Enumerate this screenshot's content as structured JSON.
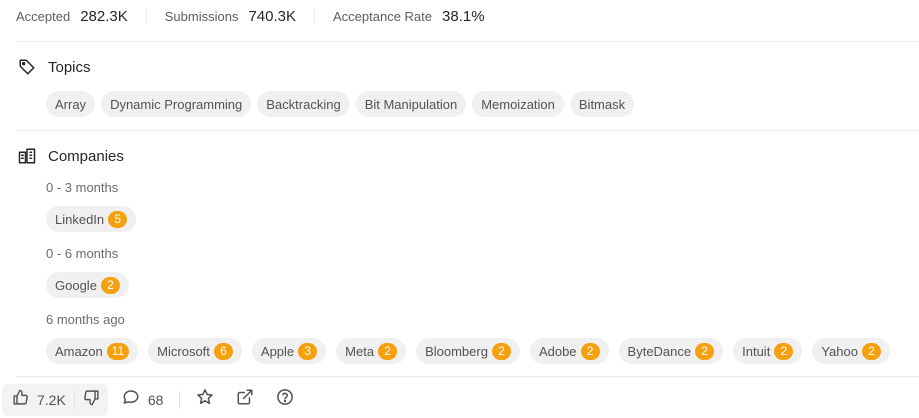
{
  "stats": {
    "accepted_label": "Accepted",
    "accepted_value": "282.3K",
    "submissions_label": "Submissions",
    "submissions_value": "740.3K",
    "acceptance_label": "Acceptance Rate",
    "acceptance_value": "38.1%"
  },
  "topics": {
    "title": "Topics",
    "tags": [
      "Array",
      "Dynamic Programming",
      "Backtracking",
      "Bit Manipulation",
      "Memoization",
      "Bitmask"
    ]
  },
  "companies": {
    "title": "Companies",
    "groups": [
      {
        "period": "0 - 3 months",
        "items": [
          {
            "name": "LinkedIn",
            "count": "5"
          }
        ]
      },
      {
        "period": "0 - 6 months",
        "items": [
          {
            "name": "Google",
            "count": "2"
          }
        ]
      },
      {
        "period": "6 months ago",
        "items": [
          {
            "name": "Amazon",
            "count": "11"
          },
          {
            "name": "Microsoft",
            "count": "6"
          },
          {
            "name": "Apple",
            "count": "3"
          },
          {
            "name": "Meta",
            "count": "2"
          },
          {
            "name": "Bloomberg",
            "count": "2"
          },
          {
            "name": "Adobe",
            "count": "2"
          },
          {
            "name": "ByteDance",
            "count": "2"
          },
          {
            "name": "Intuit",
            "count": "2"
          },
          {
            "name": "Yahoo",
            "count": "2"
          }
        ]
      }
    ]
  },
  "footer": {
    "likes": "7.2K",
    "comments": "68"
  },
  "icons": {
    "topics": "tag-icon",
    "companies": "building-icon",
    "like": "thumbs-up-icon",
    "dislike": "thumbs-down-icon",
    "comment": "comment-icon",
    "favorite": "star-icon",
    "share": "external-link-icon",
    "help": "question-icon"
  },
  "colors": {
    "badge": "#f5a10f",
    "chip_bg": "#f0f0f0",
    "text": "#262626"
  }
}
